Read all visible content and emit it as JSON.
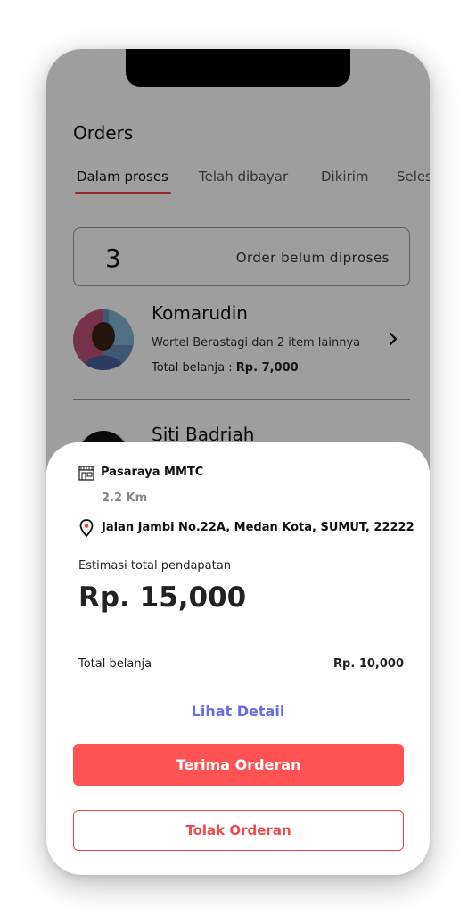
{
  "page": {
    "title": "Orders"
  },
  "tabs": [
    {
      "label": "Dalam proses",
      "active": true
    },
    {
      "label": "Telah dibayar",
      "active": false
    },
    {
      "label": "Dikirim",
      "active": false
    },
    {
      "label": "Selesai",
      "active": false
    }
  ],
  "summary": {
    "count": "3",
    "label": "Order belum diproses"
  },
  "orders": [
    {
      "name": "Komarudin",
      "items": "Wortel Berastagi dan 2 item lainnya",
      "total_prefix": "Total belanja : ",
      "total_value": "Rp. 7,000"
    },
    {
      "name": "Siti Badriah"
    }
  ],
  "sheet": {
    "store_name": "Pasaraya MMTC",
    "distance": "2.2 Km",
    "address": "Jalan Jambi No.22A, Medan Kota, SUMUT, 22222",
    "estimate_label": "Estimasi total pendapatan",
    "estimate_value": "Rp. 15,000",
    "total_label": "Total belanja",
    "total_value": "Rp. 10,000",
    "detail_link": "Lihat Detail",
    "accept_button": "Terima Orderan",
    "reject_button": "Tolak Orderan"
  },
  "icons": {
    "store": "store-icon",
    "location": "location-pin-icon",
    "chevron": "chevron-right-icon"
  },
  "colors": {
    "accent": "#ff5252",
    "link": "#6a6ae8",
    "tab_underline": "#e44444"
  }
}
